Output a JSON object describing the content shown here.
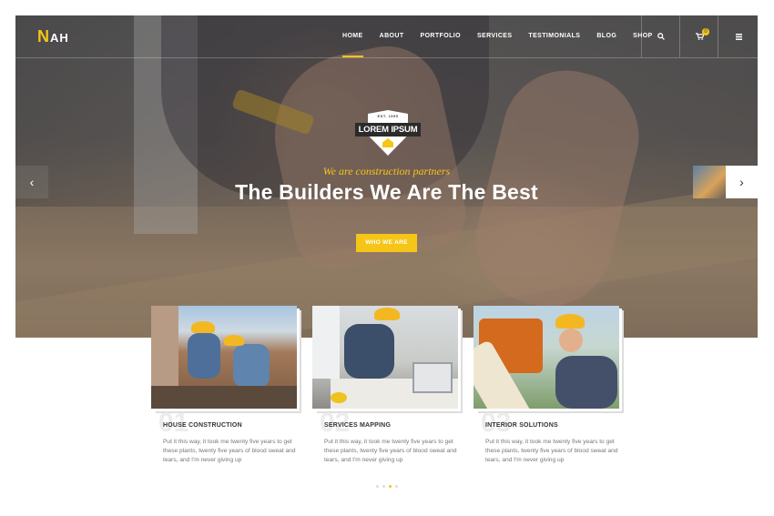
{
  "brand": {
    "logo_accent": "N",
    "logo_rest": "AH",
    "accent_color": "#f5c518"
  },
  "nav": {
    "items": [
      "HOME",
      "ABOUT",
      "PORTFOLIO",
      "SERVICES",
      "TESTIMONIALS",
      "BLOG",
      "SHOP"
    ],
    "active": "HOME",
    "cart_count": "0",
    "icons": [
      "search-icon",
      "cart-icon",
      "menu-icon"
    ]
  },
  "hero": {
    "badge_est": "EST. 1995",
    "badge_text": "LOREM IPSUM",
    "tagline": "We are construction partners",
    "title": "The Builders We Are The Best",
    "cta": "WHO WE ARE"
  },
  "services": [
    {
      "number": "01",
      "title": "HOUSE CONSTRUCTION",
      "desc": "Put it this way, it took me twenty five years to get these plants, twenty five years of blood sweat and tears, and I'm never giving up"
    },
    {
      "number": "02",
      "title": "SERVICES MAPPING",
      "desc": "Put it this way, it took me twenty five years to get these plants, twenty five years of blood sweat and tears, and I'm never giving up"
    },
    {
      "number": "03",
      "title": "INTERIOR SOLUTIONS",
      "desc": "Put it this way, it took me twenty five years to get these plants, twenty five years of blood sweat and tears, and I'm never giving up"
    }
  ],
  "pager": {
    "count": 4,
    "active_index": 2
  }
}
